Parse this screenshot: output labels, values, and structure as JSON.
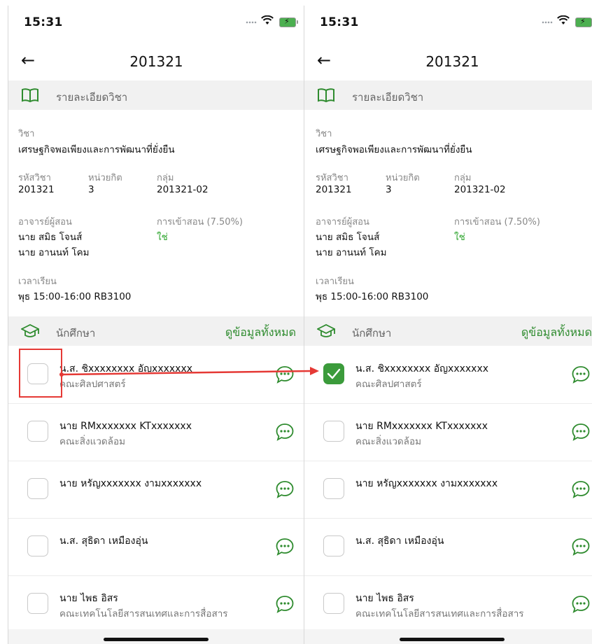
{
  "status_bar": {
    "time": "15:31"
  },
  "header": {
    "back_icon": "←",
    "title": "201321"
  },
  "course_section": {
    "label": "รายละเอียดวิชา",
    "icon": "book-icon"
  },
  "course": {
    "subject_label": "วิชา",
    "subject_value": "เศรษฐกิจพอเพียงและการพัฒนาที่ยั่งยืน",
    "code_label": "รหัสวิชา",
    "code_value": "201321",
    "credit_label": "หน่วยกิต",
    "credit_value": "3",
    "group_label": "กลุ่ม",
    "group_value": "201321-02",
    "instructor_label": "อาจารย์ผู้สอน",
    "instructors": [
      "นาย สมิธ โจนส์",
      "นาย อานนท์ โคม"
    ],
    "attendance_label": "การเข้าสอน (7.50%)",
    "attendance_value": "ใช่",
    "time_label": "เวลาเรียน",
    "time_value": "พุธ  15:00-16:00  RB3100"
  },
  "students_section": {
    "label": "นักศึกษา",
    "link": "ดูข้อมูลทั้งหมด",
    "icon": "graduation-cap-icon"
  },
  "students": [
    {
      "name": "น.ส. ชิxxxxxxxx อัญxxxxxxx",
      "faculty": "คณะศิลปศาสตร์"
    },
    {
      "name": "นาย RMxxxxxxx KTxxxxxxx",
      "faculty": "คณะสิ่งแวดล้อม"
    },
    {
      "name": "นาย หรัญxxxxxxx งามxxxxxxx",
      "faculty": ""
    },
    {
      "name": "น.ส. สุธิดา เหมืองอุ่น",
      "faculty": ""
    },
    {
      "name": "นาย ไพธ อิสร",
      "faculty": "คณะเทคโนโลยีสารสนเทศและการสื่อสาร"
    }
  ],
  "checked_state": {
    "left": [
      false,
      false,
      false,
      false,
      false
    ],
    "right": [
      true,
      false,
      false,
      false,
      false
    ]
  },
  "colors": {
    "accent_green": "#2ea52e",
    "annotation_red": "#e53935"
  }
}
